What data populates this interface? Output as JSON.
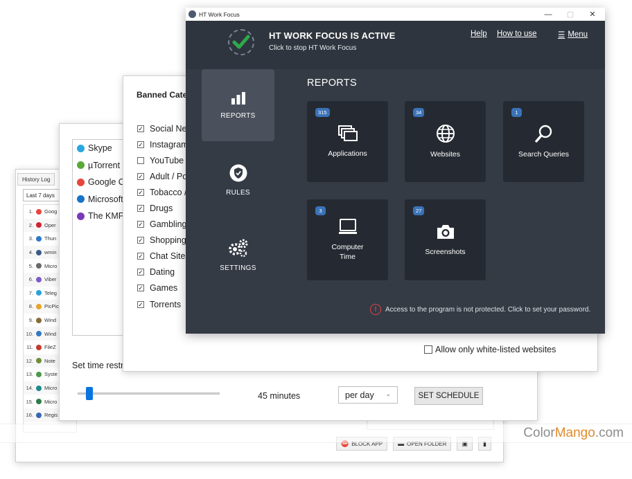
{
  "history_window": {
    "tab": "History Log",
    "range": "Last 7 days",
    "rows": [
      {
        "n": "1.",
        "name": "Goog",
        "color": "#e8453c"
      },
      {
        "n": "2.",
        "name": "Oper",
        "color": "#d1232f"
      },
      {
        "n": "3.",
        "name": "Thun",
        "color": "#2e77c9"
      },
      {
        "n": "4.",
        "name": "wmin",
        "color": "#3b5b89"
      },
      {
        "n": "5.",
        "name": "Micro",
        "color": "#6a6a6a"
      },
      {
        "n": "6.",
        "name": "Viber",
        "color": "#7b5cc6"
      },
      {
        "n": "7.",
        "name": "Teleg",
        "color": "#2aa1da"
      },
      {
        "n": "8.",
        "name": "PicPic",
        "color": "#e6a42a"
      },
      {
        "n": "9.",
        "name": "Wind",
        "color": "#8b6a3a"
      },
      {
        "n": "10.",
        "name": "Wind",
        "color": "#3478c4"
      },
      {
        "n": "11.",
        "name": "FileZ",
        "color": "#c23a2d"
      },
      {
        "n": "12.",
        "name": "Note",
        "color": "#6f8f3a"
      },
      {
        "n": "13.",
        "name": "Syste",
        "color": "#4b9a4b"
      },
      {
        "n": "14.",
        "name": "Micro",
        "color": "#1f8a8a"
      },
      {
        "n": "15.",
        "name": "Micro",
        "color": "#2f7a4a"
      },
      {
        "n": "16.",
        "name": "Regis",
        "color": "#3a66b4"
      }
    ],
    "buttons": {
      "block_app": "BLOCK APP",
      "open_folder": "OPEN FOLDER"
    }
  },
  "apps_window": {
    "apps": [
      {
        "name": "Skype",
        "color": "#2aa7e0"
      },
      {
        "name": "µTorrent",
        "color": "#5aa83a"
      },
      {
        "name": "Google Cl",
        "color": "#e8453c"
      },
      {
        "name": "Microsoft",
        "color": "#1a73c9"
      },
      {
        "name": "The KMPl",
        "color": "#7a3ab8"
      }
    ],
    "time_label": "Set time restri",
    "minutes": "45 minutes",
    "period": "per day",
    "schedule_button": "SET SCHEDULE",
    "slider_fraction": 0.06
  },
  "banned_window": {
    "title": "Banned Categ",
    "categories": [
      {
        "label": "Social Net",
        "checked": true
      },
      {
        "label": "Instagram",
        "checked": true
      },
      {
        "label": "YouTube /",
        "checked": false
      },
      {
        "label": "Adult / Po",
        "checked": true
      },
      {
        "label": "Tobacco /",
        "checked": true
      },
      {
        "label": "Drugs",
        "checked": true
      },
      {
        "label": "Gambling",
        "checked": true
      },
      {
        "label": "Shopping",
        "checked": true
      },
      {
        "label": "Chat Sites",
        "checked": true
      },
      {
        "label": "Dating",
        "checked": true
      },
      {
        "label": "Games",
        "checked": true
      },
      {
        "label": "Torrents",
        "checked": true
      }
    ],
    "allow_whitelist": "Allow only white-listed websites"
  },
  "main_window": {
    "title": "HT Work Focus",
    "status_title": "HT WORK FOCUS IS ACTIVE",
    "status_sub": "Click to stop HT Work Focus",
    "help": "Help",
    "how_to_use": "How to use",
    "menu": "Menu",
    "nav": [
      {
        "label": "REPORTS",
        "icon": "bar-chart-icon"
      },
      {
        "label": "RULES",
        "icon": "shield-icon"
      },
      {
        "label": "SETTINGS",
        "icon": "gears-icon"
      }
    ],
    "section_title": "REPORTS",
    "tiles": [
      {
        "label": "Applications",
        "count": "315",
        "icon": "windows-stack-icon"
      },
      {
        "label": "Websites",
        "count": "34",
        "icon": "globe-icon"
      },
      {
        "label": "Search Queries",
        "count": "1",
        "icon": "magnifier-icon"
      },
      {
        "label": "Computer",
        "label2": "Time",
        "count": "3",
        "icon": "monitor-icon"
      },
      {
        "label": "Screenshots",
        "count": "27",
        "icon": "camera-icon"
      }
    ],
    "warning": "Access to the program is not protected. Click to set your password.",
    "accent": "#3a73b8",
    "check_color": "#2ea84a"
  },
  "watermark": {
    "part1": "Color",
    "part2": "Mango",
    "part3": ".com"
  }
}
